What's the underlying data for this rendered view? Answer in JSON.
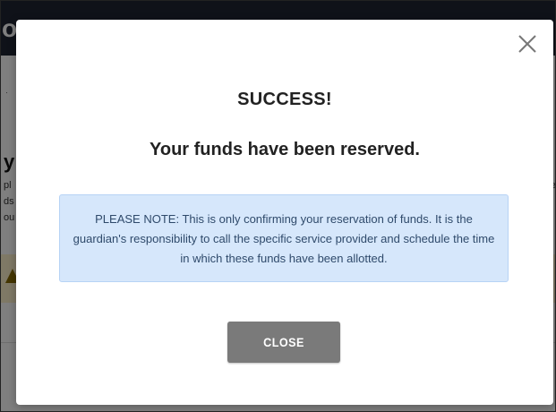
{
  "background": {
    "logo_fragment": "or",
    "heading_fragment": "y",
    "text_fragments_left": [
      "pl",
      "ds",
      "ou"
    ],
    "text_fragments_right": [
      "e",
      "t"
    ]
  },
  "modal": {
    "close_icon": "close-icon",
    "title": "SUCCESS!",
    "subtitle": "Your funds have been reserved.",
    "note": "PLEASE NOTE: This is only confirming your reservation of funds. It is the guardian's responsibility to call the specific service provider and schedule the time in which these funds have been allotted.",
    "close_button_label": "CLOSE"
  },
  "colors": {
    "note_background": "#d6e7fb",
    "button_background": "#7a7a7a",
    "topbar": "#1f2533"
  }
}
